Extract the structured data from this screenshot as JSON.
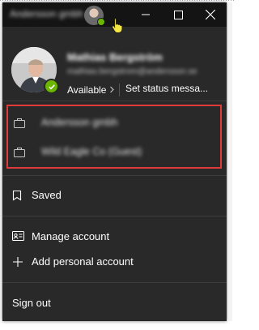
{
  "titlebar": {
    "window_name": "Andersson gmbh"
  },
  "profile": {
    "name": "Mathias Bergström",
    "email": "mathias.bergstrom@andersson.se",
    "status": "Available",
    "status_message": "Set status messa...",
    "status_color": "#6bb700"
  },
  "accounts": [
    {
      "name": "Andersson gmbh"
    },
    {
      "name": "Wild Eagle Co (Guest)"
    }
  ],
  "menu": {
    "saved": "Saved",
    "manage_account": "Manage account",
    "add_personal_account": "Add personal account",
    "sign_out": "Sign out"
  },
  "colors": {
    "window_bg": "#292929",
    "titlebar_bg": "#141414",
    "highlight": "#e03b3b"
  }
}
